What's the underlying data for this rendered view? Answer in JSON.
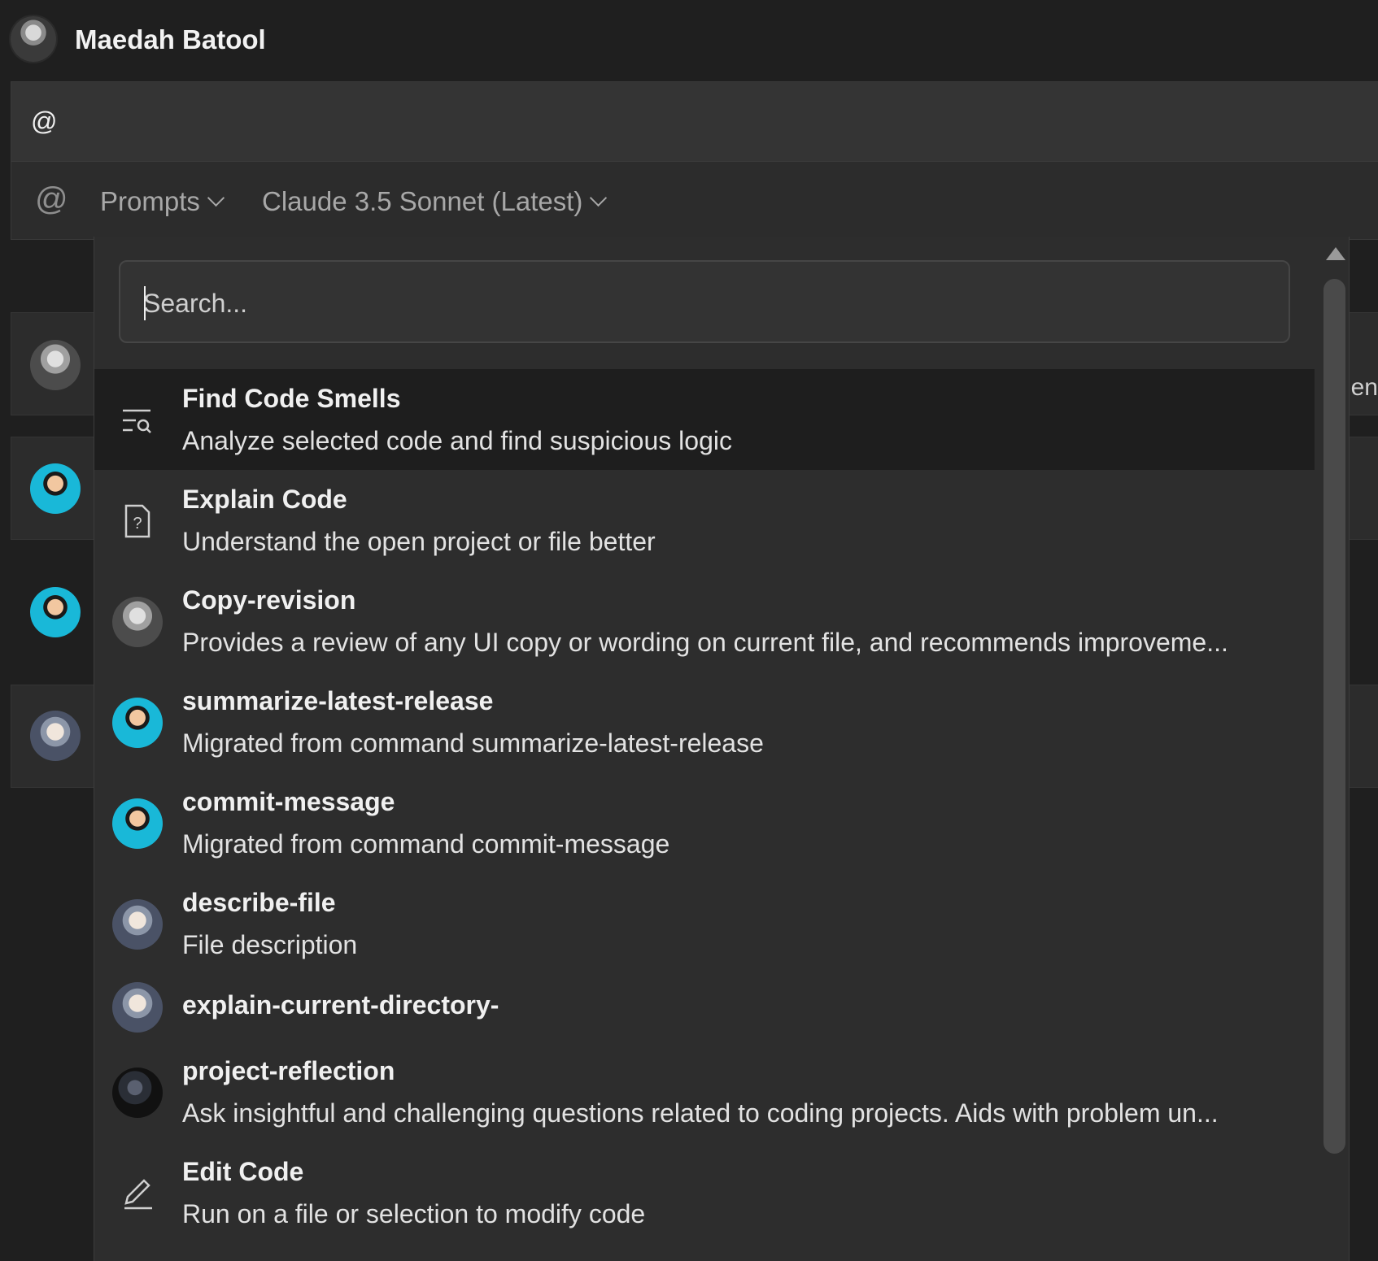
{
  "header": {
    "user_name": "Maedah Batool"
  },
  "composer": {
    "input_value": "@",
    "at_symbol": "@",
    "prompts_label": "Prompts",
    "model_label": "Claude 3.5 Sonnet (Latest)"
  },
  "background": {
    "clipped_text": "en"
  },
  "dropdown": {
    "search_placeholder": "Search...",
    "items": [
      {
        "title": "Find Code Smells",
        "description": "Analyze selected code and find suspicious logic",
        "icon": "list-search-icon",
        "selected": true
      },
      {
        "title": "Explain Code",
        "description": "Understand the open project or file better",
        "icon": "file-question-icon"
      },
      {
        "title": "Copy-revision",
        "description": "Provides a review of any UI copy or wording on current file, and recommends improveme...",
        "icon": "avatar-gray"
      },
      {
        "title": "summarize-latest-release",
        "description": "Migrated from command summarize-latest-release",
        "icon": "avatar-blue"
      },
      {
        "title": "commit-message",
        "description": "Migrated from command commit-message",
        "icon": "avatar-blue"
      },
      {
        "title": "describe-file",
        "description": "File description",
        "icon": "avatar-cartoon"
      },
      {
        "title": "explain-current-directory-",
        "description": "",
        "icon": "avatar-cartoon"
      },
      {
        "title": "project-reflection",
        "description": "Ask insightful and challenging questions related to coding projects. Aids with problem un...",
        "icon": "avatar-dark"
      },
      {
        "title": "Edit Code",
        "description": "Run on a file or selection to modify code",
        "icon": "pencil-icon"
      }
    ]
  }
}
